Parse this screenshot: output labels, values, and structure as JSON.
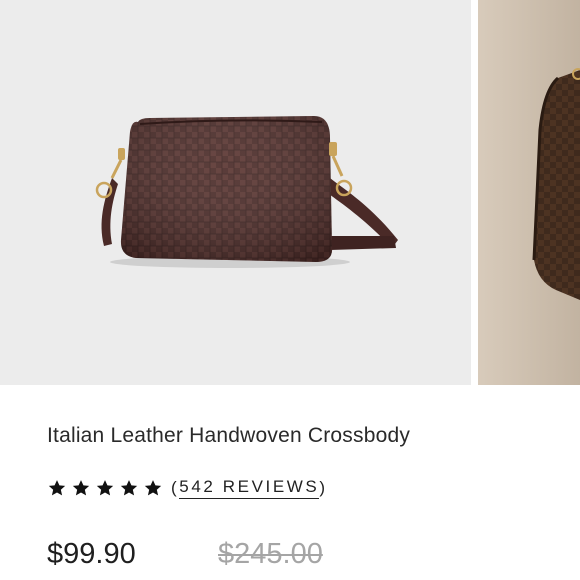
{
  "product": {
    "title": "Italian Leather Handwoven Crossbody",
    "rating": 5,
    "rating_max": 5,
    "reviews_open": "(",
    "reviews_label": "542 REVIEWS",
    "reviews_close": ")",
    "price": "$99.90",
    "compare_at_price": "$245.00"
  },
  "gallery": {
    "images": [
      "main-product-image",
      "next-product-image"
    ]
  },
  "colors": {
    "leather": "#4a2a27",
    "hardware": "#c9a45c",
    "background": "#ececec",
    "text": "#222222",
    "strike_price": "#a5a5a5"
  }
}
